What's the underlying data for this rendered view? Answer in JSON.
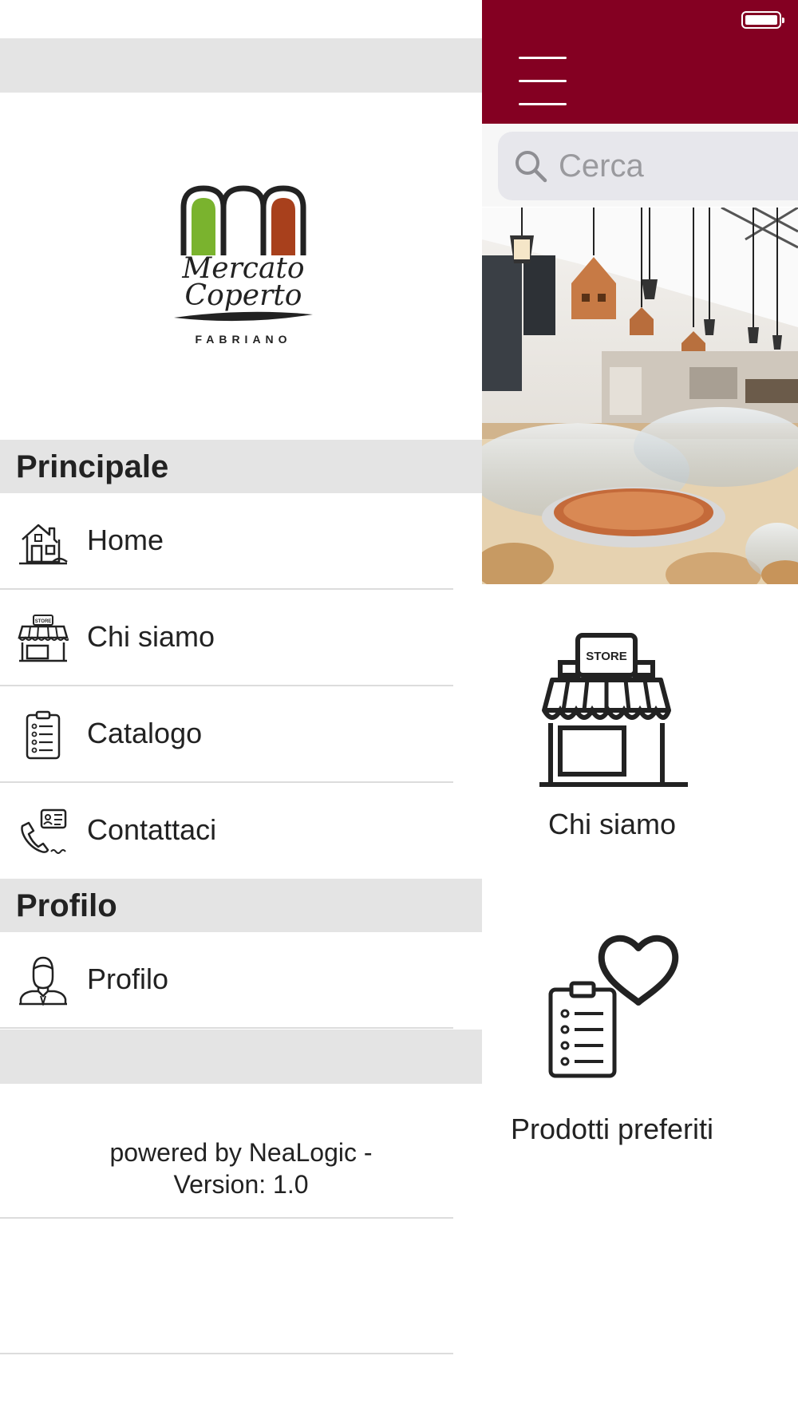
{
  "main": {
    "search": {
      "placeholder": "Cerca"
    },
    "tiles": [
      {
        "label": "Chi siamo",
        "icon": "store-icon"
      },
      {
        "label": "Prodotti preferiti",
        "icon": "favorite-list-icon"
      }
    ],
    "hero_image": "bakery-counter-photo"
  },
  "drawer": {
    "logo": {
      "text_lines": [
        "Mercato",
        "Coperto"
      ],
      "sub": "FABRIANO"
    },
    "sections": [
      {
        "title": "Principale",
        "items": [
          {
            "label": "Home",
            "icon": "home-icon"
          },
          {
            "label": "Chi siamo",
            "icon": "store-icon"
          },
          {
            "label": "Catalogo",
            "icon": "clipboard-list-icon"
          },
          {
            "label": "Contattaci",
            "icon": "phone-contact-icon"
          }
        ]
      },
      {
        "title": "Profilo",
        "items": [
          {
            "label": "Profilo",
            "icon": "user-icon"
          }
        ]
      }
    ],
    "footer": {
      "line1": "powered by NeaLogic -",
      "line2": "Version: 1.0"
    }
  },
  "colors": {
    "brand": "#840022",
    "section_bg": "#e4e4e4",
    "logo_green": "#7ab32e",
    "logo_rust": "#a8401c"
  }
}
